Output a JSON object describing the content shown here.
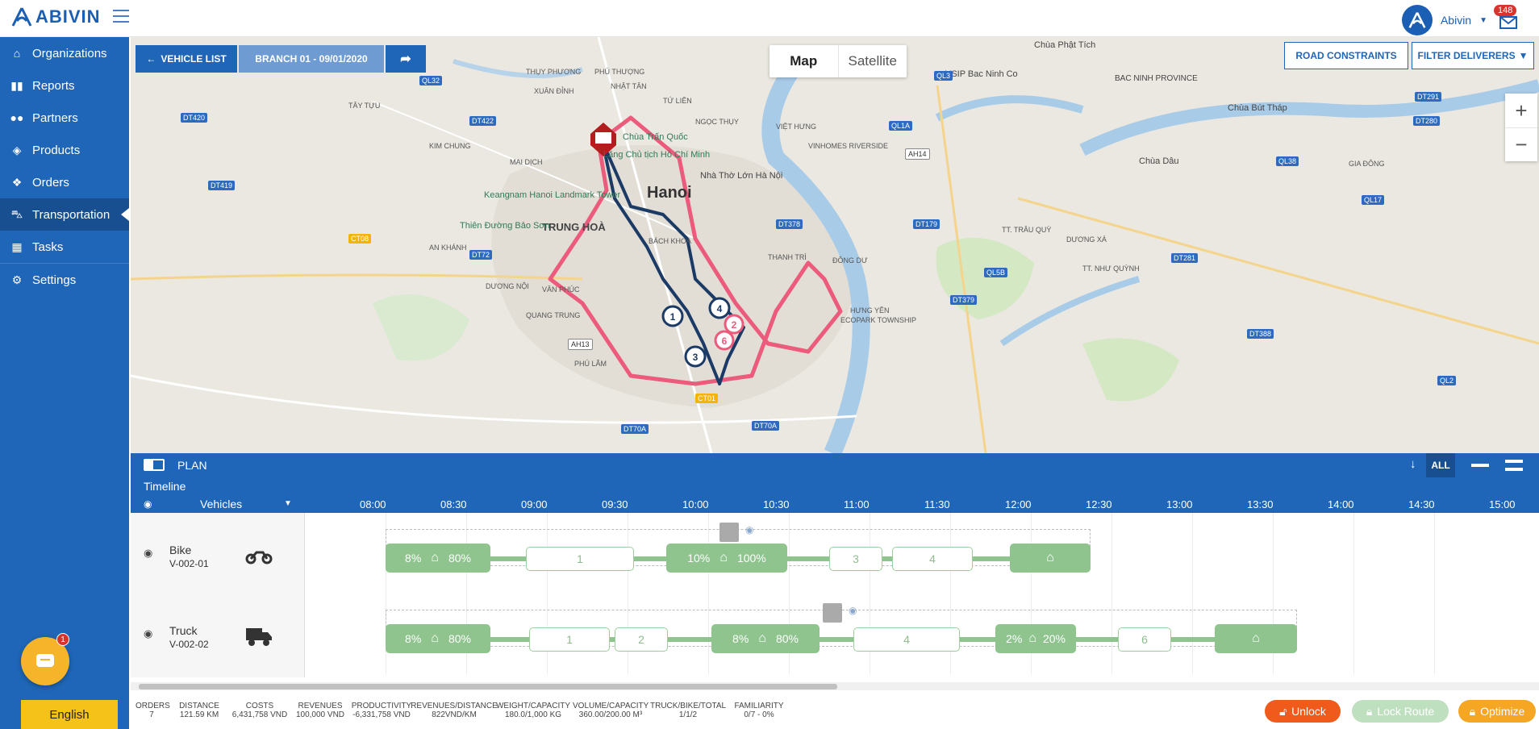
{
  "app": {
    "logo_text": "ABIVIN",
    "user_name": "Abivin",
    "notification_count": "148",
    "language": "English",
    "chat_badge": "1"
  },
  "sidebar": {
    "items": [
      {
        "label": "Organizations",
        "icon": "home-icon"
      },
      {
        "label": "Reports",
        "icon": "bar-chart-icon"
      },
      {
        "label": "Partners",
        "icon": "users-icon"
      },
      {
        "label": "Products",
        "icon": "boxes-icon"
      },
      {
        "label": "Orders",
        "icon": "cubes-icon"
      },
      {
        "label": "Transportation",
        "icon": "road-icon"
      },
      {
        "label": "Tasks",
        "icon": "calendar-icon"
      },
      {
        "label": "Settings",
        "icon": "gear-icon"
      }
    ]
  },
  "map": {
    "vehicle_list": "VEHICLE LIST",
    "branch": "BRANCH 01 - 09/01/2020",
    "tab_map": "Map",
    "tab_satellite": "Satellite",
    "road_constraints": "ROAD CONSTRAINTS",
    "filter_deliverers": "FILTER DELIVERERS",
    "zoom_in": "+",
    "zoom_out": "−",
    "labels": [
      "THỤY PHƯƠNG",
      "PHÚ THƯỢNG",
      "NHẬT TÂN",
      "XUÂN ĐỈNH",
      "TỨ LIÊN",
      "NGỌC THỤY",
      "VIỆT HƯNG",
      "TÂY TỰU",
      "KIM CHUNG",
      "MAI DỊCH",
      "Hanoi",
      "TRUNG HOÀ",
      "Keangnam Hanoi Landmark Tower",
      "Thiên Đường Bảo Sơn",
      "AN KHÁNH",
      "DƯƠNG NỘI",
      "VĂN PHÚC",
      "QUANG TRUNG",
      "PHÚ LÃM",
      "BÁCH KHOA",
      "THANH TRÌ",
      "ĐÔNG DƯ",
      "HƯNG YÊN",
      "VINHOMES RIVERSIDE",
      "Nhà Thờ Lớn Hà Nội",
      "Chùa Phật Tích",
      "VSIP Bac Ninh Co",
      "BAC NINH PROVINCE",
      "Chùa Bút Tháp",
      "Chùa Dâu",
      "GIA ĐÔNG",
      "TT. TRÂU QUỲ",
      "DƯƠNG XÁ",
      "TT. NHƯ QUỲNH",
      "ECOPARK TOWNSHIP",
      "Chùa Trấn Quốc",
      "Lăng Chủ tịch Hồ Chí Minh"
    ],
    "roads": [
      "QL32",
      "DT420",
      "DT422",
      "DT419",
      "DT72",
      "CT08",
      "QL3",
      "QL1A",
      "AH14",
      "DT378",
      "DT179",
      "QL5B",
      "DT379",
      "DT281",
      "QL38",
      "QL17",
      "DT291",
      "DT280",
      "CT01",
      "DT70A",
      "AH13",
      "DT388",
      "QL2",
      "DT70A"
    ],
    "stops": [
      "1",
      "2",
      "3",
      "4",
      "6"
    ]
  },
  "plan": {
    "title": "PLAN",
    "timeline_label": "Timeline",
    "vehicles_label": "Vehicles",
    "all_label": "ALL",
    "hours": [
      "08:00",
      "08:30",
      "09:00",
      "09:30",
      "10:00",
      "10:30",
      "11:00",
      "11:30",
      "12:00",
      "12:30",
      "13:00",
      "13:30",
      "14:00",
      "14:30",
      "15:00"
    ],
    "vehicles": [
      {
        "type": "Bike",
        "id": "V-002-01",
        "icon": "motorbike-icon",
        "blocks": [
          "8%",
          "80%",
          "1",
          "10%",
          "100%",
          "3",
          "4"
        ]
      },
      {
        "type": "Truck",
        "id": "V-002-02",
        "icon": "truck-icon",
        "blocks": [
          "8%",
          "80%",
          "1",
          "2",
          "8%",
          "80%",
          "4",
          "2%",
          "20%",
          "6"
        ]
      }
    ]
  },
  "stats": [
    {
      "label": "ORDERS",
      "value": "7"
    },
    {
      "label": "DISTANCE",
      "value": "121.59 KM"
    },
    {
      "label": "COSTS",
      "value": "6,431,758 VND"
    },
    {
      "label": "REVENUES",
      "value": "100,000 VND"
    },
    {
      "label": "PRODUCTIVITY",
      "value": "-6,331,758 VND"
    },
    {
      "label": "REVENUES/DISTANCE",
      "value": "822VND/KM"
    },
    {
      "label": "WEIGHT/CAPACITY",
      "value": "180.0/1,000 KG"
    },
    {
      "label": "VOLUME/CAPACITY",
      "value": "360.00/200.00 M³"
    },
    {
      "label": "TRUCK/BIKE/TOTAL",
      "value": "1/1/2"
    },
    {
      "label": "FAMILIARITY",
      "value": "0/7 - 0%"
    }
  ],
  "actions": {
    "unlock": "Unlock",
    "lock_route": "Lock Route",
    "optimize": "Optimize"
  },
  "colors": {
    "primary": "#1f66b8",
    "route_red": "#ec5a7c",
    "route_navy": "#1b3a66",
    "green": "#8fc48f",
    "unlock": "#f05a1a",
    "optimize": "#f5a623"
  }
}
